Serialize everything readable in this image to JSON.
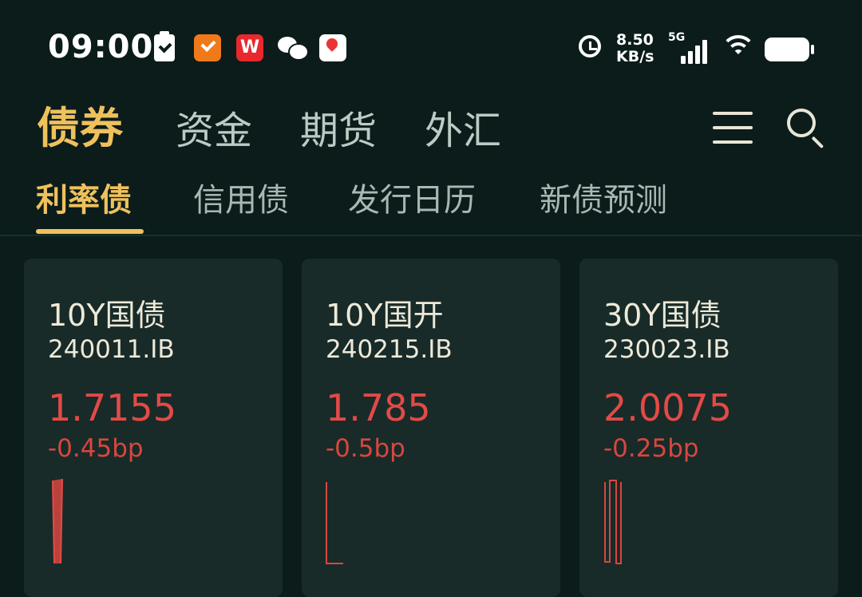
{
  "status_bar": {
    "time": "09:00",
    "net_speed_value": "8.50",
    "net_speed_unit": "KB/s",
    "network_type": "5G",
    "app_icons": [
      "clipboard-check-icon",
      "tasks-icon",
      "wps-icon",
      "wechat-icon",
      "map-icon"
    ],
    "wps_label": "W"
  },
  "main_tabs": [
    {
      "label": "债券",
      "active": true
    },
    {
      "label": "资金",
      "active": false
    },
    {
      "label": "期货",
      "active": false
    },
    {
      "label": "外汇",
      "active": false
    }
  ],
  "sub_tabs": [
    {
      "label": "利率债",
      "active": true
    },
    {
      "label": "信用债",
      "active": false
    },
    {
      "label": "发行日历",
      "active": false
    },
    {
      "label": "新债预测",
      "active": false
    }
  ],
  "cards": [
    {
      "name": "10Y国债",
      "code": "240011.IB",
      "yield": "1.7155",
      "change": "-0.45bp"
    },
    {
      "name": "10Y国开",
      "code": "240215.IB",
      "yield": "1.785",
      "change": "-0.5bp"
    },
    {
      "name": "30Y国债",
      "code": "230023.IB",
      "yield": "2.0075",
      "change": "-0.25bp"
    }
  ],
  "colors": {
    "background": "#0b1c1b",
    "card": "#182b29",
    "accent": "#efc15c",
    "down_red": "#e34a46",
    "text": "#eee9d8",
    "tab_inactive": "#bccbc4"
  }
}
